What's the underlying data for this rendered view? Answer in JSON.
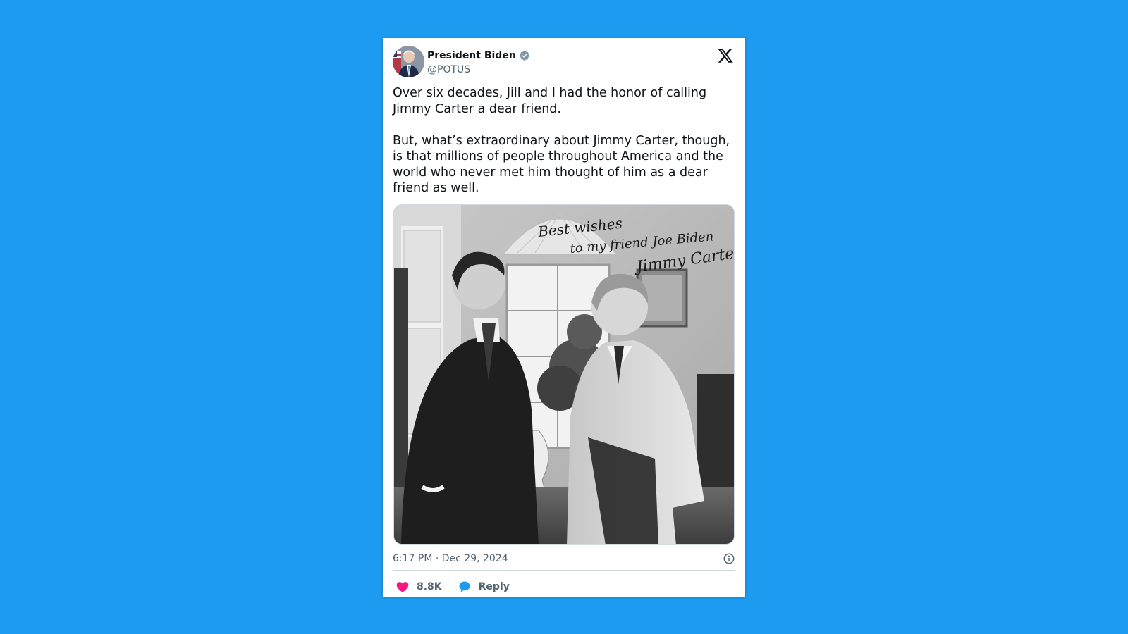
{
  "author": {
    "display_name": "President Biden",
    "handle": "@POTUS",
    "verified": true
  },
  "tweet": {
    "paragraphs": [
      "Over six decades, Jill and I had the honor of calling Jimmy Carter a dear friend.",
      "But, what’s extraordinary about Jimmy Carter, though, is that millions of people throughout America and the world who never met him thought of him as a dear friend as well."
    ],
    "timestamp": "6:17 PM · Dec 29, 2024"
  },
  "photo": {
    "inscription": [
      "Best wishes",
      "to my friend Joe Biden",
      "Jimmy Carter"
    ]
  },
  "actions": {
    "likes_count": "8.8K",
    "reply_label": "Reply"
  },
  "icons": {
    "brand": "x-logo-icon",
    "verified": "verified-badge-icon",
    "info": "info-icon",
    "like": "heart-icon",
    "reply": "reply-bubble-icon"
  },
  "colors": {
    "background": "#1d9bf0",
    "card": "#ffffff",
    "text": "#0f1419",
    "muted": "#536471",
    "heart": "#f91880",
    "reply": "#1d9bf0",
    "verified_badge": "#829aab"
  }
}
